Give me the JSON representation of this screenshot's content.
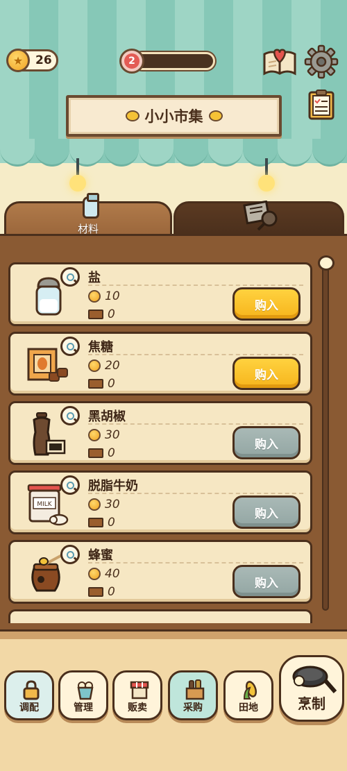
{
  "header": {
    "coins": "26",
    "level": "2",
    "level_progress": 0,
    "sign_title": "小小市集"
  },
  "tabs": {
    "materials_label": "材料"
  },
  "items": [
    {
      "name": "盐",
      "price": "10",
      "stock": "0",
      "buy_label": "购入",
      "enabled": true
    },
    {
      "name": "焦糖",
      "price": "20",
      "stock": "0",
      "buy_label": "购入",
      "enabled": true
    },
    {
      "name": "黑胡椒",
      "price": "30",
      "stock": "0",
      "buy_label": "购入",
      "enabled": false
    },
    {
      "name": "脱脂牛奶",
      "price": "30",
      "stock": "0",
      "buy_label": "购入",
      "enabled": false
    },
    {
      "name": "蜂蜜",
      "price": "40",
      "stock": "0",
      "buy_label": "购入",
      "enabled": false
    }
  ],
  "nav": {
    "mix": "调配",
    "manage": "管理",
    "sell": "贩卖",
    "purchase": "采购",
    "farm": "田地",
    "cook": "烹制"
  },
  "colors": {
    "buy_enabled": "#f6b41c",
    "buy_disabled": "#93a6a3",
    "awning": "#86c8b7"
  }
}
